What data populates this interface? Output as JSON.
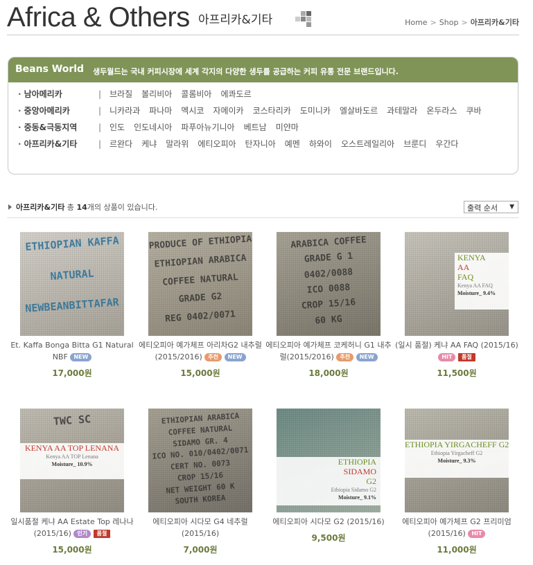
{
  "header": {
    "title_en": "Africa & Others",
    "title_kr": "아프리카&기타",
    "breadcrumb": [
      "Home",
      "Shop",
      "아프리카&기타"
    ]
  },
  "beans_world": {
    "title": "Beans World",
    "description": "생두월드는 국내 커피시장에 세계 각지의 다양한 생두를 공급하는 커피 유통 전문 브랜드입니다.",
    "regions": [
      {
        "name": "남아메리카",
        "countries": [
          "브라질",
          "볼리비아",
          "콜롬비아",
          "에콰도르"
        ]
      },
      {
        "name": "중앙아메리카",
        "countries": [
          "니카라과",
          "파나마",
          "멕시코",
          "자메이카",
          "코스타리카",
          "도미니카",
          "엘살바도르",
          "과테말라",
          "온두라스",
          "쿠바"
        ]
      },
      {
        "name": "중동&극동지역",
        "countries": [
          "인도",
          "인도네시아",
          "파푸아뉴기니아",
          "베트남",
          "미얀마"
        ]
      },
      {
        "name": "아프리카&기타",
        "countries": [
          "르완다",
          "케냐",
          "말라위",
          "에티오피아",
          "탄자니아",
          "예멘",
          "하와이",
          "오스트레일리아",
          "브룬디",
          "우간다"
        ]
      }
    ]
  },
  "summary": {
    "category": "아프리카&기타",
    "text_before": " 총 ",
    "count": "14",
    "text_after": "개의 상품이 있습니다."
  },
  "sort": {
    "selected": "출력 순서"
  },
  "colors": {
    "accent_green": "#7f9456",
    "price_green": "#6b7a3c"
  },
  "products": [
    {
      "name": "Et. Kaffa Bonga Bitta G1 Natural NBF",
      "badges": [
        {
          "label": "NEW",
          "type": "new"
        }
      ],
      "price": "17,000원",
      "stamps": [
        "ETHIOPIAN KAFFA",
        "NATURAL",
        "NEWBEANBITTAFAR"
      ]
    },
    {
      "name": "에티오피아 예가체프 아리차G2 내추럴(2015/2016)",
      "badges": [
        {
          "label": "추천",
          "type": "rec"
        },
        {
          "label": "NEW",
          "type": "new"
        }
      ],
      "price": "15,000원",
      "stamps": [
        "PRODUCE OF ETHIOPIA",
        "ETHIOPIAN ARABICA",
        "COFFEE NATURAL",
        "GRADE G2",
        "REG 0402/0071"
      ]
    },
    {
      "name": "에티오피아 예가체프 코케허니 G1 내추럴(2015/2016)",
      "badges": [
        {
          "label": "추천",
          "type": "rec"
        },
        {
          "label": "NEW",
          "type": "new"
        }
      ],
      "price": "18,000원",
      "stamps": [
        "ARABICA COFFEE",
        "GRADE G 1",
        "0402/0088",
        "ICO 0088",
        "CROP 15/16",
        "60 KG"
      ]
    },
    {
      "name": "(일시 품절) 케냐 AA FAQ (2015/16)",
      "badges": [
        {
          "label": "HIT",
          "type": "hit"
        },
        {
          "label": "품절",
          "type": "sold"
        }
      ],
      "price": "11,500원",
      "label": {
        "l1": "KENYA",
        "l2": "AA",
        "l3": "FAQ",
        "sub": "Kenya AA FAQ",
        "moisture": "Moisture_ 9.4%"
      }
    },
    {
      "name": "일시품절 케냐 AA Estate Top 레나나 (2015/16)",
      "badges": [
        {
          "label": "인기",
          "type": "pop"
        },
        {
          "label": "품절",
          "type": "sold"
        }
      ],
      "price": "15,000원",
      "stamps": [
        "TWC SC"
      ],
      "label": {
        "l1": "KENYA AA TOP LENANA",
        "sub": "Kenya AA TOP Lenana",
        "moisture": "Moisture_ 10.9%"
      }
    },
    {
      "name": "에티오피아 시다모 G4 네추럴 (2015/16)",
      "badges": [],
      "price": "7,000원",
      "stamps": [
        "ETHIOPIAN ARABICA",
        "COFFEE NATURAL",
        "SIDAMO GR. 4",
        "ICO NO. 010/0402/0071",
        "CERT NO. 0073",
        "CROP 15/16",
        "NET WEIGHT 60 K",
        "SOUTH KOREA"
      ]
    },
    {
      "name": "에티오피아 시다모 G2 (2015/16)",
      "badges": [],
      "price": "9,500원",
      "label": {
        "l1": "ETHIOPIA",
        "l2": "SIDAMO",
        "l3": "G2",
        "sub": "Ethiopia Sidamo G2",
        "moisture": "Moisture_ 9.1%"
      }
    },
    {
      "name": "에티오피아 예가체프 G2 프리미엄 (2015/16)",
      "badges": [
        {
          "label": "HIT",
          "type": "hit"
        }
      ],
      "price": "11,000원",
      "label": {
        "l1": "ETHIOPIA YIRGACHEFF G2",
        "sub": "Ethiopia Yirgacheff G2",
        "moisture": "Moisture_ 9.3%"
      }
    }
  ]
}
